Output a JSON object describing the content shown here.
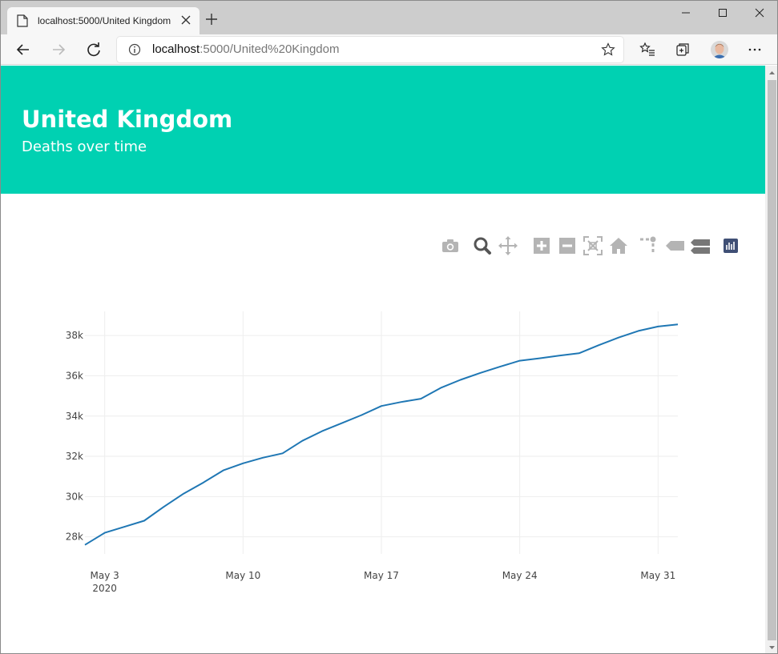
{
  "browser": {
    "tab_title": "localhost:5000/United Kingdom",
    "url_host": "localhost",
    "url_rest": ":5000/United%20Kingdom"
  },
  "page": {
    "title": "United Kingdom",
    "subtitle": "Deaths over time"
  },
  "modebar": {
    "icons": [
      "camera-icon",
      "zoom-icon",
      "pan-icon",
      "zoom-in-icon",
      "zoom-out-icon",
      "autoscale-icon",
      "reset-axes-icon",
      "spike-lines-icon",
      "hover-closest-icon",
      "hover-compare-icon",
      "plotly-logo-icon"
    ]
  },
  "colors": {
    "hero": "#00d1b2",
    "line": "#1f77b4"
  },
  "chart_data": {
    "type": "line",
    "title": "",
    "xlabel": "",
    "ylabel": "",
    "x": [
      "2020-05-02",
      "2020-05-03",
      "2020-05-04",
      "2020-05-05",
      "2020-05-06",
      "2020-05-07",
      "2020-05-08",
      "2020-05-09",
      "2020-05-10",
      "2020-05-11",
      "2020-05-12",
      "2020-05-13",
      "2020-05-14",
      "2020-05-15",
      "2020-05-16",
      "2020-05-17",
      "2020-05-18",
      "2020-05-19",
      "2020-05-20",
      "2020-05-21",
      "2020-05-22",
      "2020-05-23",
      "2020-05-24",
      "2020-05-25",
      "2020-05-26",
      "2020-05-27",
      "2020-05-28",
      "2020-05-29",
      "2020-05-30",
      "2020-05-31",
      "2020-06-01"
    ],
    "series": [
      {
        "values": [
          27600,
          28200,
          28500,
          28800,
          29500,
          30150,
          30700,
          31300,
          31650,
          31930,
          32150,
          32770,
          33250,
          33650,
          34050,
          34500,
          34700,
          34860,
          35400,
          35800,
          36140,
          36450,
          36750,
          36870,
          37000,
          37120,
          37520,
          37900,
          38230,
          38450,
          38550
        ]
      }
    ],
    "xticks": [
      {
        "date": "2020-05-03",
        "label": "May 3",
        "sublabel": "2020"
      },
      {
        "date": "2020-05-10",
        "label": "May 10",
        "sublabel": ""
      },
      {
        "date": "2020-05-17",
        "label": "May 17",
        "sublabel": ""
      },
      {
        "date": "2020-05-24",
        "label": "May 24",
        "sublabel": ""
      },
      {
        "date": "2020-05-31",
        "label": "May 31",
        "sublabel": ""
      }
    ],
    "yticks": [
      28000,
      30000,
      32000,
      34000,
      36000,
      38000
    ],
    "ytick_labels": [
      "28k",
      "30k",
      "32k",
      "34k",
      "36k",
      "38k"
    ],
    "xlim": [
      "2020-05-02",
      "2020-06-01"
    ],
    "ylim": [
      27150,
      39200
    ],
    "grid": true,
    "legend": "none"
  }
}
